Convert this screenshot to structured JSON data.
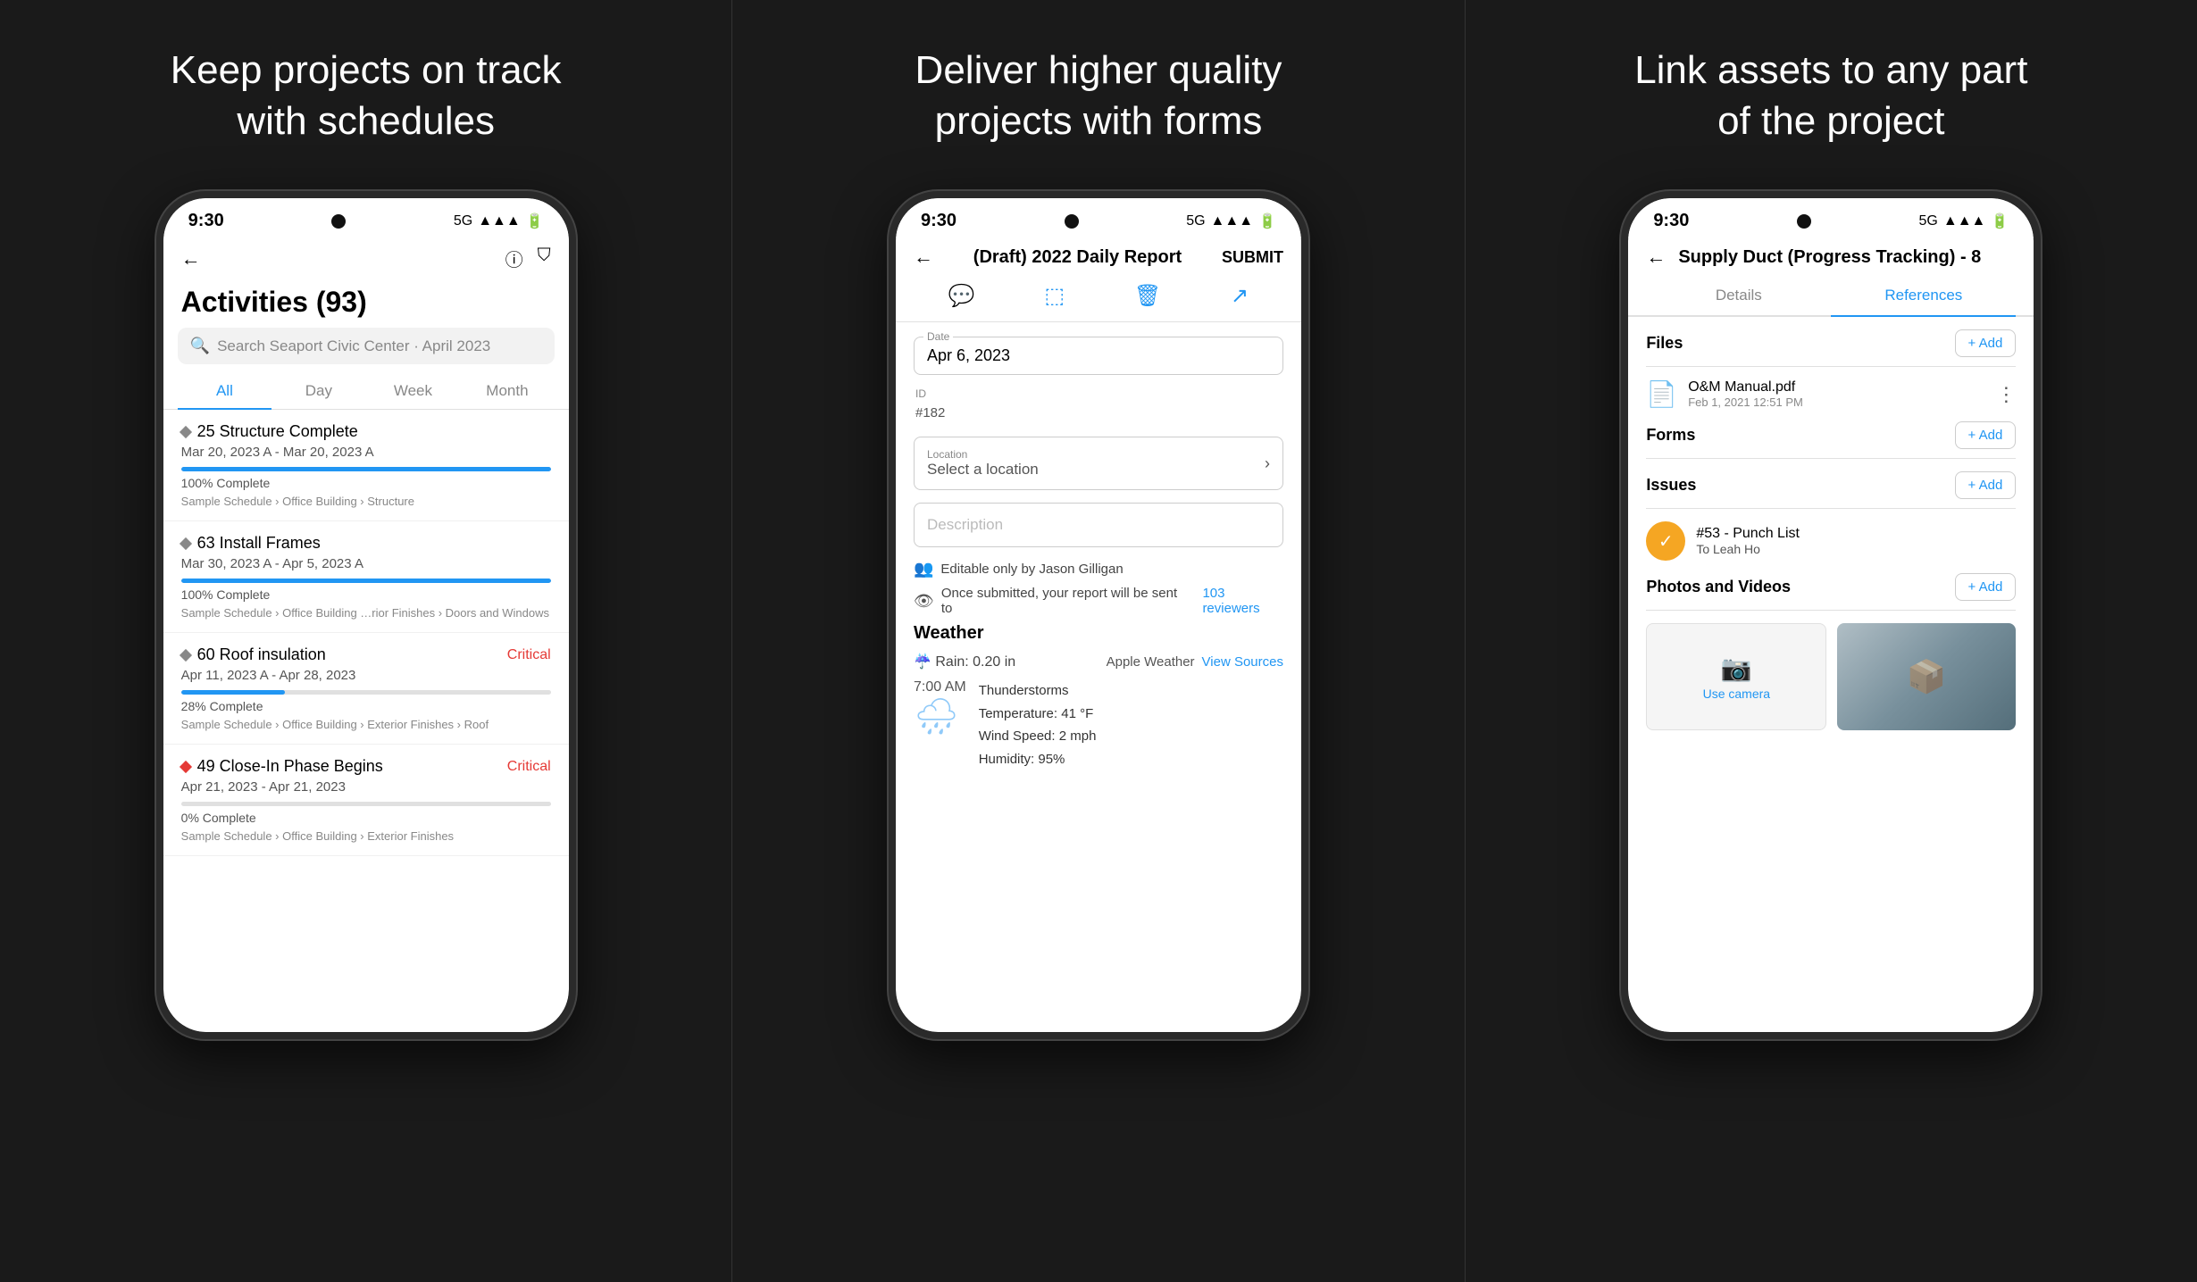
{
  "panels": [
    {
      "id": "panel-1",
      "title": "Keep projects on track\nwith schedules",
      "phone": {
        "time": "9:30",
        "signal": "5G",
        "header": {
          "title": "Activities (93)"
        },
        "search": {
          "placeholder": "Search Seaport Civic Center · April 2023"
        },
        "tabs": [
          "All",
          "Day",
          "Week",
          "Month"
        ],
        "active_tab": 0,
        "activities": [
          {
            "number": "25",
            "title": "Structure Complete",
            "date": "Mar 20, 2023 A - Mar 20, 2023 A",
            "progress": 100,
            "progress_label": "100% Complete",
            "breadcrumb": "Sample Schedule › Office Building › Structure",
            "critical": false,
            "dot_color": "gray"
          },
          {
            "number": "63",
            "title": "Install Frames",
            "date": "Mar 30, 2023 A - Apr 5, 2023 A",
            "progress": 100,
            "progress_label": "100% Complete",
            "breadcrumb": "Sample Schedule › Office Building …rior Finishes › Doors and Windows",
            "critical": false,
            "dot_color": "gray"
          },
          {
            "number": "60",
            "title": "Roof insulation",
            "date": "Apr 11, 2023 A - Apr 28, 2023",
            "progress": 28,
            "progress_label": "28% Complete",
            "breadcrumb": "Sample Schedule › Office Building › Exterior Finishes › Roof",
            "critical": true,
            "critical_label": "Critical",
            "dot_color": "gray"
          },
          {
            "number": "49",
            "title": "Close-In Phase Begins",
            "date": "Apr 21, 2023 - Apr 21, 2023",
            "progress": 0,
            "progress_label": "0% Complete",
            "breadcrumb": "Sample Schedule › Office Building › Exterior Finishes",
            "critical": true,
            "critical_label": "Critical",
            "dot_color": "red"
          }
        ]
      }
    },
    {
      "id": "panel-2",
      "title": "Deliver higher quality\nprojects with forms",
      "phone": {
        "time": "9:30",
        "signal": "5G",
        "report_title": "(Draft) 2022 Daily Report",
        "submit_label": "SUBMIT",
        "date_label": "Date",
        "date_value": "Apr 6, 2023",
        "id_label": "ID",
        "id_value": "#182",
        "location_label": "Location",
        "location_placeholder": "Select a location",
        "description_placeholder": "Description",
        "editable_by": "Editable only by Jason Gilligan",
        "submit_info": "Once submitted, your report will be sent to",
        "reviewers": "103 reviewers",
        "weather_title": "Weather",
        "rain_label": "Rain: 0.20 in",
        "apple_weather": "Apple Weather",
        "view_sources": "View Sources",
        "weather_time": "7:00 AM",
        "weather_condition": "Thunderstorms",
        "temperature": "Temperature: 41 °F",
        "wind_speed": "Wind Speed: 2 mph",
        "humidity": "Humidity: 95%"
      }
    },
    {
      "id": "panel-3",
      "title": "Link assets to any part\nof the project",
      "phone": {
        "time": "9:30",
        "signal": "5G",
        "asset_title": "Supply Duct (Progress Tracking) - 8",
        "tabs": [
          "Details",
          "References"
        ],
        "active_tab": 1,
        "sections": {
          "files": {
            "title": "Files",
            "add_label": "+ Add",
            "items": [
              {
                "name": "O&M Manual.pdf",
                "date": "Feb 1, 2021 12:51 PM"
              }
            ]
          },
          "forms": {
            "title": "Forms",
            "add_label": "+ Add"
          },
          "issues": {
            "title": "Issues",
            "add_label": "+ Add",
            "items": [
              {
                "number": "#53",
                "title": "#53 - Punch List",
                "assignee": "To Leah Ho"
              }
            ]
          },
          "photos": {
            "title": "Photos and Videos",
            "add_label": "+ Add",
            "use_camera": "Use camera"
          }
        }
      }
    }
  ]
}
